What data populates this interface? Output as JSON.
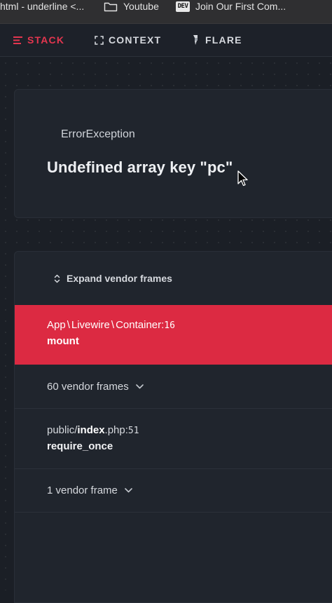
{
  "bookmarks": [
    {
      "label": "html - underline <...",
      "icon": "page-icon"
    },
    {
      "label": "Youtube",
      "icon": "folder-icon"
    },
    {
      "label": "Join Our First Com...",
      "icon": "dev-icon",
      "badge": "DEV"
    }
  ],
  "navbar": {
    "tabs": [
      {
        "label": "STACK",
        "icon": "stack-icon",
        "active": true
      },
      {
        "label": "CONTEXT",
        "icon": "context-icon",
        "active": false
      },
      {
        "label": "FLARE",
        "icon": "flare-icon",
        "active": false
      }
    ]
  },
  "exception": {
    "class": "ErrorException",
    "message": "Undefined array key \"pc\""
  },
  "stack": {
    "expand_label": "Expand vendor frames",
    "frames": [
      {
        "type": "app",
        "path_parts": [
          "App",
          "Livewire",
          "Container"
        ],
        "line": "16",
        "method": "mount",
        "active": true
      },
      {
        "type": "vendor",
        "label": "60 vendor frames"
      },
      {
        "type": "app",
        "dir": "public/",
        "file": "index",
        "ext": ".php",
        "line": "51",
        "method": "require_once",
        "active": false
      },
      {
        "type": "vendor",
        "label": "1 vendor frame"
      }
    ]
  },
  "colors": {
    "accent": "#dc2a42",
    "background": "#1b1f26",
    "card": "#20252d"
  }
}
